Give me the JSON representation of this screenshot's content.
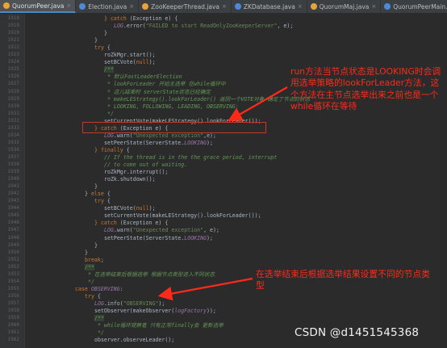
{
  "tabs": [
    {
      "label": "QuorumPeer.java",
      "active": true,
      "icon": "java-class-icon"
    },
    {
      "label": "Election.java",
      "active": false,
      "icon": "java-class-icon"
    },
    {
      "label": "ZooKeeperThread.java",
      "active": false,
      "icon": "java-class-icon"
    },
    {
      "label": "ZKDatabase.java",
      "active": false,
      "icon": "java-class-icon"
    },
    {
      "label": "QuorumMaj.java",
      "active": false,
      "icon": "java-class-icon"
    },
    {
      "label": "QuorumPeerMain.java",
      "active": false,
      "icon": "java-class-icon"
    },
    {
      "label": "ServerCnxnFactory.java",
      "active": false,
      "icon": "java-class-icon"
    },
    {
      "label": "NettyServerCnxnFactory",
      "active": false,
      "icon": "java-class-icon"
    }
  ],
  "lines": [
    {
      "n": "1918",
      "indent": 6,
      "html": "<span class='kw'>} catch</span> (Exception e) {"
    },
    {
      "n": "1919",
      "indent": 8,
      "html": "<span class='fld'>LOG</span>.error(<span class='str'>\"FAILED to start ReadOnlyZooKeeperServer\"</span>, e);"
    },
    {
      "n": "1920",
      "indent": 6,
      "html": "}"
    },
    {
      "n": "1921",
      "indent": 4,
      "html": "}"
    },
    {
      "n": "1922",
      "indent": 4,
      "html": "<span class='kw'>try</span> {"
    },
    {
      "n": "1923",
      "indent": 6,
      "html": "roZkMgr.start();"
    },
    {
      "n": "1924",
      "indent": 6,
      "html": "setBCVote(<span class='kw'>null</span>);"
    },
    {
      "n": "1925",
      "indent": 6,
      "html": "<span class='cm hl'>/**</span>"
    },
    {
      "n": "1926",
      "indent": 6,
      "html": "<span class='cm'> * 默认FastLeaderElection</span>"
    },
    {
      "n": "1927",
      "indent": 6,
      "html": "<span class='cm'> * lookForLeader 开始主选举 在while循环中</span>"
    },
    {
      "n": "1928",
      "indent": 6,
      "html": "<span class='cm'> * 这儿结束时 serverState状态已经确定</span>"
    },
    {
      "n": "1929",
      "indent": 6,
      "html": "<span class='cm'> * makeLEStrategy().lookForLeader() 返回一个VOTE对象 确定了节点的状态</span>"
    },
    {
      "n": "1930",
      "indent": 6,
      "html": "<span class='cm'> * LOOKING, FOLLOWING, LEADING, OBSERVING;</span>"
    },
    {
      "n": "1931",
      "indent": 6,
      "html": "<span class='cm'> */</span>"
    },
    {
      "n": "1932",
      "indent": 6,
      "html": "setCurrentVote(makeLEStrategy().lookForLeader());"
    },
    {
      "n": "1933",
      "indent": 4,
      "html": "<span class='kw'>} catch</span> (Exception e) {"
    },
    {
      "n": "1934",
      "indent": 6,
      "html": "<span class='fld'>LOG</span>.warn(<span class='str'>\"Unexpected exception\"</span>,e);"
    },
    {
      "n": "1935",
      "indent": 6,
      "html": "setPeerState(ServerState.<span class='fld'>LOOKING</span>);"
    },
    {
      "n": "1936",
      "indent": 4,
      "html": "<span class='kw'>} finally</span> {"
    },
    {
      "n": "1937",
      "indent": 6,
      "html": "<span class='cm'>// If the thread is in the the grace period, interrupt</span>"
    },
    {
      "n": "1938",
      "indent": 6,
      "html": "<span class='cm'>// to come out of waiting.</span>"
    },
    {
      "n": "1939",
      "indent": 6,
      "html": "roZkMgr.interrupt();"
    },
    {
      "n": "1940",
      "indent": 6,
      "html": "roZk.shutdown();"
    },
    {
      "n": "1941",
      "indent": 4,
      "html": "}"
    },
    {
      "n": "1942",
      "indent": 2,
      "html": "} <span class='kw'>else</span> {"
    },
    {
      "n": "1943",
      "indent": 4,
      "html": "<span class='kw'>try</span> {"
    },
    {
      "n": "1944",
      "indent": 6,
      "html": "setBCVote(<span class='kw'>null</span>);"
    },
    {
      "n": "1945",
      "indent": 6,
      "html": "setCurrentVote(makeLEStrategy().lookForLeader());"
    },
    {
      "n": "1946",
      "indent": 4,
      "html": "<span class='kw'>} catch</span> (Exception e) {"
    },
    {
      "n": "1947",
      "indent": 6,
      "html": "<span class='fld'>LOG</span>.warn(<span class='str'>\"Unexpected exception\"</span>, e);"
    },
    {
      "n": "1948",
      "indent": 6,
      "html": "setPeerState(ServerState.<span class='fld'>LOOKING</span>);"
    },
    {
      "n": "1949",
      "indent": 4,
      "html": "}"
    },
    {
      "n": "1950",
      "indent": 2,
      "html": "}"
    },
    {
      "n": "1951",
      "indent": 2,
      "html": "<span class='kw'>break</span>;"
    },
    {
      "n": "1952",
      "indent": 2,
      "html": "<span class='cm hl'>/**</span>"
    },
    {
      "n": "1953",
      "indent": 2,
      "html": "<span class='cm'> * 在选举结束后根据选举 根据节点类型进入不同状态</span>"
    },
    {
      "n": "1954",
      "indent": 2,
      "html": "<span class='cm'> */</span>"
    },
    {
      "n": "1955",
      "indent": 0,
      "html": "<span class='kw'>case</span> <span class='fld'>OBSERVING</span>:"
    },
    {
      "n": "1956",
      "indent": 2,
      "html": "<span class='kw'>try</span> {"
    },
    {
      "n": "1957",
      "indent": 4,
      "html": "<span class='fld'>LOG</span>.info(<span class='str'>\"OBSERVING\"</span>);"
    },
    {
      "n": "1958",
      "indent": 4,
      "html": "setObserver(makeObserver(<span class='fld'>logFactory</span>));"
    },
    {
      "n": "1959",
      "indent": 4,
      "html": "<span class='cm hl'>/**</span>"
    },
    {
      "n": "1960",
      "indent": 4,
      "html": "<span class='cm'> * while循环观察者 只有正常finally会 更新选举</span>"
    },
    {
      "n": "1961",
      "indent": 4,
      "html": "<span class='cm'> */</span>"
    },
    {
      "n": "1962",
      "indent": 4,
      "html": "observer.observeLeader();"
    }
  ],
  "annotations": {
    "first": "run方法当节点状态是LOOKING时会调用选举策略的lookForLeader方法，这个方法在主节点选举出来之前也是一个while循环在等待",
    "second": "在选举结束后根据选举结果设置不同的节点类型"
  },
  "watermark": "CSDN @d1451545368",
  "colors": {
    "annotation": "#ff2a1a",
    "keyword": "#cc7832",
    "string": "#6a8759",
    "comment": "#629755",
    "field": "#9876aa"
  }
}
